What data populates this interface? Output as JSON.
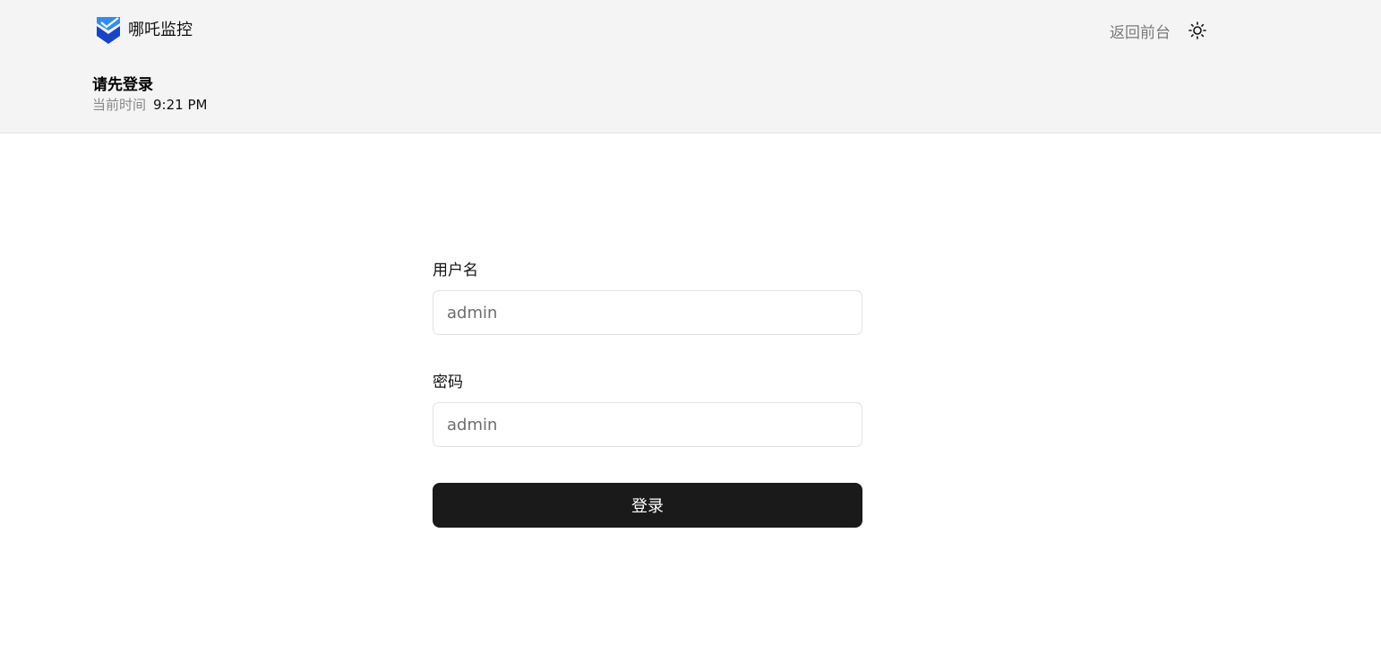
{
  "header": {
    "brand_name": "哪吒监控",
    "back_link": "返回前台",
    "theme_icon": "sun-icon",
    "login_prompt": "请先登录",
    "time_label": "当前时间",
    "time_value": "9:21 PM"
  },
  "form": {
    "username_label": "用户名",
    "username_placeholder": "admin",
    "password_label": "密码",
    "password_placeholder": "admin",
    "submit_label": "登录"
  },
  "colors": {
    "header_bg": "#f4f4f4",
    "button_bg": "#1a1a1a",
    "logo_light": "#2f8df0",
    "logo_dark": "#1546c9"
  }
}
